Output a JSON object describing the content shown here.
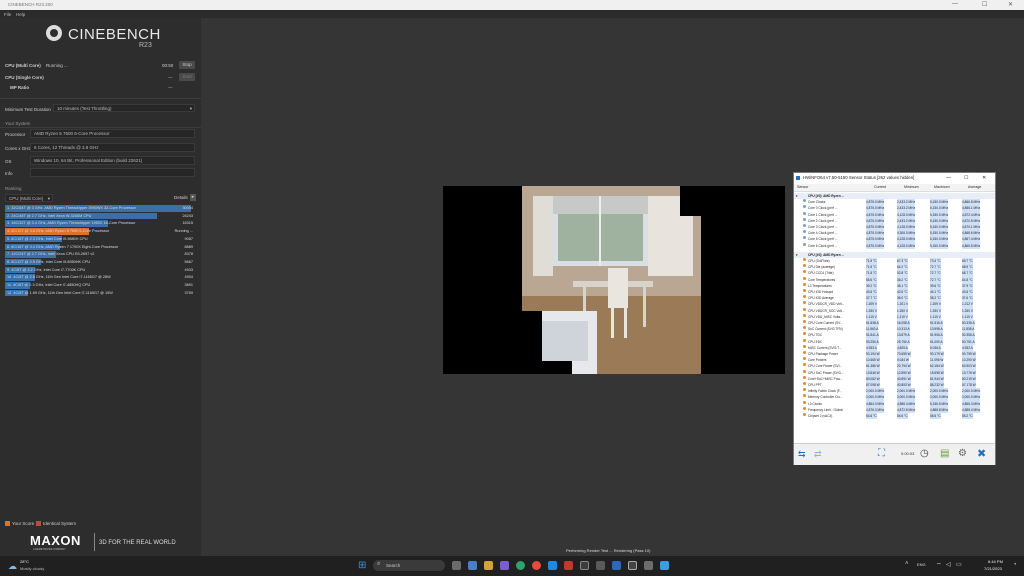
{
  "window": {
    "title": "CINEBENCH R23.200",
    "controls": [
      "—",
      "☐",
      "✕"
    ]
  },
  "menu": [
    "File",
    "Help"
  ],
  "logo": {
    "name": "CINEBENCH",
    "version": "R23"
  },
  "tests": [
    {
      "label": "CPU (Multi Core)",
      "status": "Running ...",
      "timer": "00:50",
      "button": "Stop"
    },
    {
      "label": "CPU (Single Core)",
      "status": "",
      "timer": "---",
      "button": "Start"
    },
    {
      "label": "MP Ratio",
      "status": "",
      "timer": "---",
      "button": ""
    }
  ],
  "min_duration": {
    "label": "Minimum Test Duration",
    "value": "10 minutes (Test Throttling)"
  },
  "system": {
    "header": "Your System",
    "fields": [
      {
        "label": "Processor",
        "value": "AMD Ryzen 5 7600 6-Core Processor"
      },
      {
        "label": "Cores x GHz",
        "value": "6 Cores, 12 Threads @ 3.8 GHz"
      },
      {
        "label": "OS",
        "value": "Windows 10, 64 Bit, Professional Edition (build 22621)"
      },
      {
        "label": "Info",
        "value": ""
      }
    ]
  },
  "ranking": {
    "header": "Ranking",
    "dropdown": "CPU (Multi Core)",
    "details": "Details",
    "rows": [
      {
        "name": "1. 32C/64T @ 3 GHz, AMD Ryzen Threadripper 3990WX 32-Core Processor",
        "score": "30054",
        "pct": 0.98,
        "mine": false
      },
      {
        "name": "2. 24C/48T @ 2.7 GHz, Intel Xeon W-3265M CPU",
        "score": "24243",
        "pct": 0.8,
        "mine": false
      },
      {
        "name": "3. 16C/32T @ 3.4 GHz, AMD Ryzen Threadripper 1950X 16-Core Processor",
        "score": "16315",
        "pct": 0.54,
        "mine": false
      },
      {
        "name": "4. 6C/12T @ 3.8 GHz, AMD Ryzen 5 7600 6-Core Processor",
        "score": "Running ...",
        "pct": 0.44,
        "mine": true
      },
      {
        "name": "5. 8C/16T @ 2.3 GHz, Intel Core i9-9880H CPU",
        "score": "9087",
        "pct": 0.3,
        "mine": false
      },
      {
        "name": "6. 8C/16T @ 3.4 GHz, AMD Ryzen 7 1700X Eight-Core Processor",
        "score": "8889",
        "pct": 0.29,
        "mine": false
      },
      {
        "name": "7. 12C/24T @ 2.7 GHz, Intel Xeon CPU E5-2697 v2",
        "score": "8378",
        "pct": 0.27,
        "mine": false
      },
      {
        "name": "8. 6C/12T @ 2.9 GHz, Intel Core i9-8950HK CPU",
        "score": "5667",
        "pct": 0.19,
        "mine": false
      },
      {
        "name": "9. 4C/8T @ 4.2 GHz, Intel Core i7-7700K CPU",
        "score": "4933",
        "pct": 0.16,
        "mine": false
      },
      {
        "name": "10. 4C/8T @ 2.8 GHz, 11th Gen Intel Core i7-1165G7 @ 28W",
        "score": "4904",
        "pct": 0.16,
        "mine": false
      },
      {
        "name": "11. 4C/8T @ 2.3 GHz, Intel Core i7-4850HQ CPU",
        "score": "3891",
        "pct": 0.13,
        "mine": false
      },
      {
        "name": "12. 4C/8T @ 1.69 GHz, 11th Gen Intel Core i7-1165G7 @ 15W",
        "score": "3769",
        "pct": 0.12,
        "mine": false
      }
    ]
  },
  "legend": [
    {
      "label": "Your Score",
      "color": "#d9722a"
    },
    {
      "label": "Identical System",
      "color": "#b0523a"
    }
  ],
  "brand": {
    "logo": "MAXON",
    "sub": "A NEMETSCHEK COMPANY",
    "tagline": "3D FOR THE REAL WORLD"
  },
  "render_status": "Performing Render Test ... Rendering (Pass 10)",
  "taskbar": {
    "weather_temp": "28°C",
    "weather_desc": "Mostly cloudy",
    "search": "Search",
    "time": "6:44 PM",
    "date": "7/21/2023",
    "lang": "ENG"
  },
  "hwinfo": {
    "title": "HWiNFO64 v7.50-5150 Sensor Status [262 values hidden]",
    "columns": [
      "Sensor",
      "Current",
      "Minimum",
      "Maximum",
      "Average"
    ],
    "groups": [
      {
        "name": "CPU [#0]: AMD Ryzen ...",
        "rows": [
          [
            "Core Clocks",
            "4,875.0 MHz",
            "2,433.2 MHz",
            "5,150.0 MHz",
            "4,866.8 MHz"
          ],
          [
            "Core 0 Clock (perf ...",
            "4,875.0 MHz",
            "2,433.2 MHz",
            "5,150.0 MHz",
            "4,856.1 MHz"
          ],
          [
            "Core 1 Clock (perf ...",
            "4,875.0 MHz",
            "4,128.0 MHz",
            "5,150.0 MHz",
            "4,872.4 MHz"
          ],
          [
            "Core 2 Clock (perf ...",
            "4,875.0 MHz",
            "2,433.2 MHz",
            "5,150.0 MHz",
            "4,870.5 MHz"
          ],
          [
            "Core 3 Clock (perf ...",
            "4,875.0 MHz",
            "4,128.0 MHz",
            "5,150.0 MHz",
            "4,870.1 MHz"
          ],
          [
            "Core 4 Clock (perf ...",
            "4,875.0 MHz",
            "4,306.0 MHz",
            "5,150.0 MHz",
            "4,868.6 MHz"
          ],
          [
            "Core 5 Clock (perf ...",
            "4,875.0 MHz",
            "4,128.0 MHz",
            "5,150.0 MHz",
            "4,867.4 MHz"
          ],
          [
            "Core 6 Clock (perf ...",
            "4,875.0 MHz",
            "4,128.0 MHz",
            "5,150.0 MHz",
            "4,865.5 MHz"
          ]
        ]
      },
      {
        "name": "CPU [#0]: AMD Ryzen ...",
        "rows": [
          [
            "CPU (Tctl/Tdie)",
            "71.5 °C",
            "67.3 °C",
            "73.4 °C",
            "69.7 °C"
          ],
          [
            "CPU Die (average)",
            "71.5 °C",
            "64.2 °C",
            "72.7 °C",
            "68.9 °C"
          ],
          [
            "CPU CCD1 (Tdie)",
            "71.5 °C",
            "52.8 °C",
            "72.7 °C",
            "68.7 °C"
          ],
          [
            "Core Temperatures",
            "65.6 °C",
            "36.2 °C",
            "72.7 °C",
            "64.8 °C"
          ],
          [
            "L3 Temperatures",
            "39.2 °C",
            "36.1 °C",
            "39.6 °C",
            "37.9 °C"
          ],
          [
            "CPU IOD Hotspot",
            "43.5 °C",
            "42.5 °C",
            "44.1 °C",
            "43.5 °C"
          ],
          [
            "CPU IOD Average",
            "37.7 °C",
            "36.0 °C",
            "38.2 °C",
            "37.6 °C"
          ],
          [
            "CPU VDDCR_VDD Volt...",
            "1.209 V",
            "1.201 V",
            "1.209 V",
            "1.212 V"
          ],
          [
            "CPU VDDCR_SOC Volt...",
            "1.250 V",
            "1.250 V",
            "1.250 V",
            "1.250 V"
          ],
          [
            "CPU VDD_MISC Volta...",
            "1.110 V",
            "1.110 V",
            "1.110 V",
            "1.110 V"
          ],
          [
            "CPU Core Current (SV...",
            "51.838 A",
            "16.258 A",
            "51.516 A",
            "50.335 A"
          ],
          [
            "SoC Current (SVI3 TFN)",
            "11.863 A",
            "10.313 A",
            "13.998 A",
            "11.838 A"
          ],
          [
            "CPU TDC",
            "51.841 A",
            "13.879 A",
            "51.906 A",
            "50.356 A"
          ],
          [
            "CPU EDC",
            "53.250 A",
            "25.750 A",
            "61.000 A",
            "50.751 A"
          ],
          [
            "MISC Current (SVI3 T...",
            "4.933 A",
            "4.825 A",
            "5.036 A",
            "4.932 A"
          ],
          [
            "CPU Package Power",
            "90.194 W",
            "70.655 W",
            "90.179 W",
            "90.795 W"
          ],
          [
            "Core Powers",
            "10.665 W",
            "0.034 W",
            "11.096 W",
            "10.290 W"
          ],
          [
            "CPU Core Power (SVI...",
            "61.386 W",
            "20.794 W",
            "62.184 W",
            "60.903 W"
          ],
          [
            "CPU SoC Power (SVI3...",
            "13.846 W",
            "12.890 W",
            "15.698 W",
            "13.776 W"
          ],
          [
            "Core+SoC+MISC Pow...",
            "80.082 W",
            "40.891 W",
            "81.944 W",
            "80.219 W"
          ],
          [
            "CPU PPT",
            "87.098 W",
            "40.853 W",
            "88.232 W",
            "87.178 W"
          ],
          [
            "Infinity Fabric Clock (F...",
            "2,000.0 MHz",
            "2,000.0 MHz",
            "2,000.0 MHz",
            "2,000.0 MHz"
          ],
          [
            "Memory Controller Clo...",
            "3,000.0 MHz",
            "3,000.0 MHz",
            "3,000.0 MHz",
            "3,000.0 MHz"
          ],
          [
            "L3 Clocks",
            "4,864.3 MHz",
            "4,856.4 MHz",
            "5,156.5 MHz",
            "4,866.3 MHz"
          ],
          [
            "Frequency Limit - Global",
            "4,876.3 MHz",
            "4,872.8 MHz",
            "4,888.8 MHz",
            "4,888.4 MHz"
          ],
          [
            "Chipset 2 (vAC3)",
            "54.6 °C",
            "54.6 °C",
            "56.5 °C",
            "55.2 °C"
          ]
        ]
      }
    ],
    "timer": "0:00:03"
  }
}
